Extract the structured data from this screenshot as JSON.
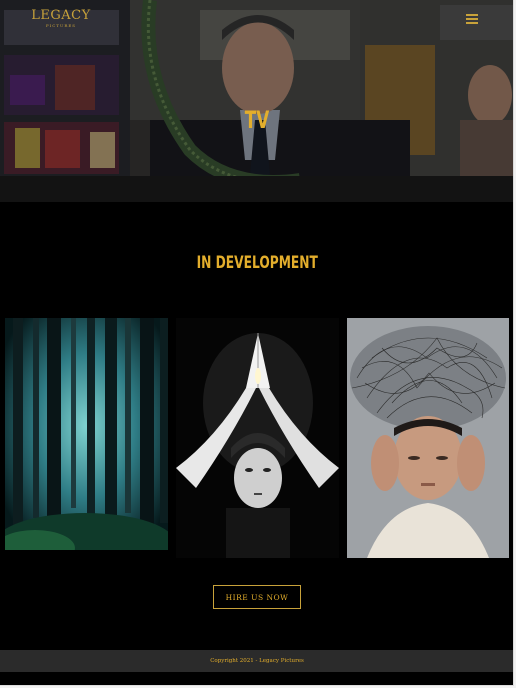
{
  "header": {
    "logo_text": "LEGACY",
    "logo_subtext": "PICTURES",
    "menu_icon": "hamburger-icon"
  },
  "hero": {
    "title": "TV"
  },
  "section": {
    "title": "IN DEVELOPMENT",
    "cards": [
      {
        "image": "misty-forest"
      },
      {
        "image": "praying-hands-portrait"
      },
      {
        "image": "tangled-wires-head"
      }
    ]
  },
  "cta": {
    "label": "HIRE US NOW"
  },
  "footer": {
    "copyright": "Copyright 2021 - Legacy Pictures"
  },
  "colors": {
    "accent": "#e3ae2c",
    "background": "#000000",
    "footer_bg": "#2b2b2b"
  }
}
